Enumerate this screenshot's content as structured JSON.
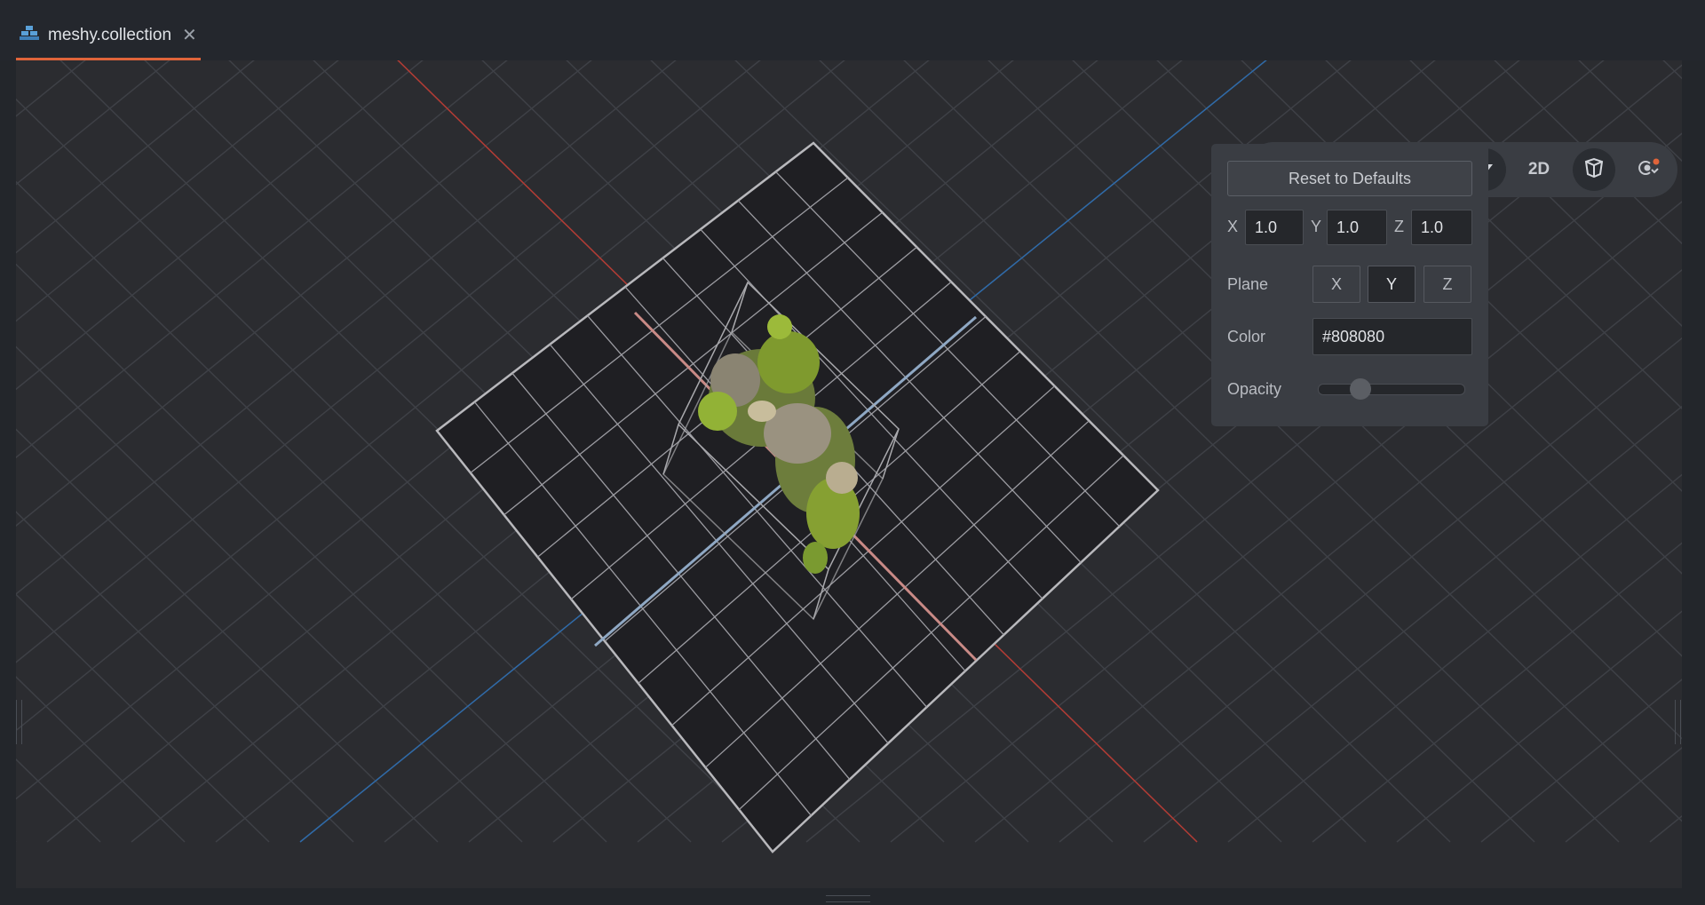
{
  "tab": {
    "icon": "collection-icon",
    "title": "meshy.collection",
    "close_symbol": "✕"
  },
  "toolbar": {
    "move_tool": "move-icon",
    "rotate_tool": "rotate-icon",
    "scale_tool": "scale-icon",
    "grid_toggle": "grid-icon",
    "grid_dropdown": "caret-down-icon",
    "mode_2d_label": "2D",
    "perspective_toggle": "perspective-cube-icon",
    "visibility_filter": "visibility-filter-icon",
    "notification_color": "#e0643a"
  },
  "grid_settings": {
    "reset_label": "Reset to Defaults",
    "size": [
      {
        "axis": "X",
        "value": "1.0"
      },
      {
        "axis": "Y",
        "value": "1.0"
      },
      {
        "axis": "Z",
        "value": "1.0"
      }
    ],
    "plane_label": "Plane",
    "plane_options": [
      "X",
      "Y",
      "Z"
    ],
    "plane_selected": "Y",
    "color_label": "Color",
    "color_value": "#808080",
    "opacity_label": "Opacity",
    "opacity_value": 0.25
  },
  "colors": {
    "accent": "#e0643a",
    "x_axis": "#c0413a",
    "z_axis": "#3a78c0"
  }
}
